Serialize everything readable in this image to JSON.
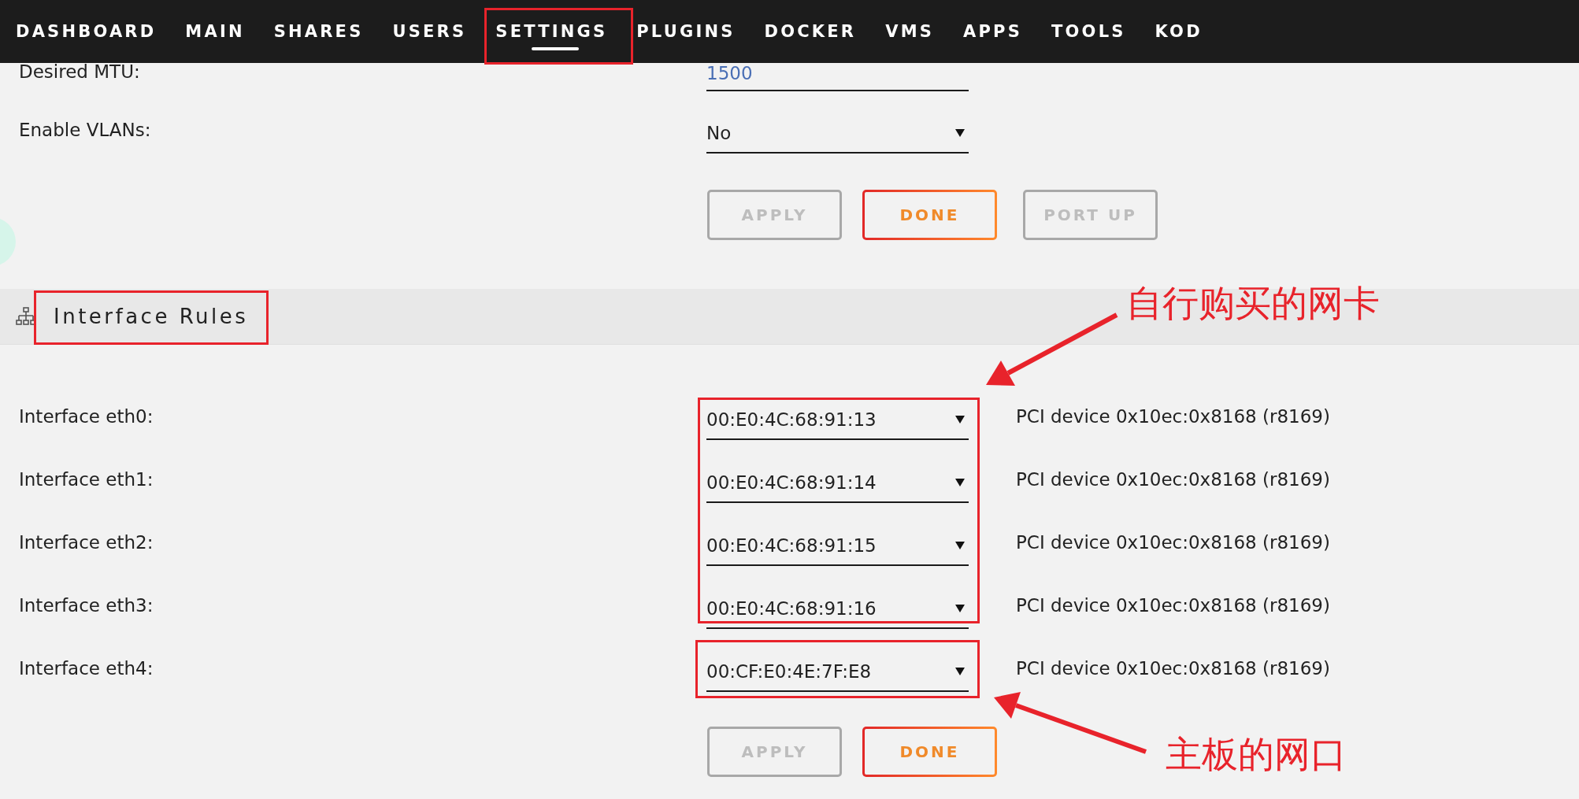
{
  "nav": {
    "items": [
      {
        "label": "DASHBOARD",
        "selected": false
      },
      {
        "label": "MAIN",
        "selected": false
      },
      {
        "label": "SHARES",
        "selected": false
      },
      {
        "label": "USERS",
        "selected": false
      },
      {
        "label": "SETTINGS",
        "selected": true
      },
      {
        "label": "PLUGINS",
        "selected": false
      },
      {
        "label": "DOCKER",
        "selected": false
      },
      {
        "label": "VMS",
        "selected": false
      },
      {
        "label": "APPS",
        "selected": false
      },
      {
        "label": "TOOLS",
        "selected": false
      },
      {
        "label": "KOD",
        "selected": false
      }
    ]
  },
  "settings": [
    {
      "kind": "input",
      "label": "Desired MTU:",
      "value": "1500"
    },
    {
      "kind": "select",
      "label": "Enable VLANs:",
      "value": "No"
    }
  ],
  "buttons": [
    {
      "label": "APPLY",
      "disabled": true
    },
    {
      "label": "DONE",
      "disabled": false
    },
    {
      "label": "PORT UP",
      "disabled": true
    }
  ],
  "section": {
    "title": "Interface Rules"
  },
  "interfaces": [
    {
      "label": "Interface eth0:",
      "value": "00:E0:4C:68:91:13",
      "description": "PCI device 0x10ec:0x8168 (r8169)"
    },
    {
      "label": "Interface eth1:",
      "value": "00:E0:4C:68:91:14",
      "description": "PCI device 0x10ec:0x8168 (r8169)"
    },
    {
      "label": "Interface eth2:",
      "value": "00:E0:4C:68:91:15",
      "description": "PCI device 0x10ec:0x8168 (r8169)"
    },
    {
      "label": "Interface eth3:",
      "value": "00:E0:4C:68:91:16",
      "description": "PCI device 0x10ec:0x8168 (r8169)"
    },
    {
      "label": "Interface eth4:",
      "value": "00:CF:E0:4E:7F:E8",
      "description": "PCI device 0x10ec:0x8168 (r8169)"
    }
  ],
  "interface_buttons": [
    {
      "label": "APPLY",
      "disabled": true
    },
    {
      "label": "DONE",
      "disabled": false
    }
  ],
  "annotations": [
    {
      "text": "自行购买的网卡"
    },
    {
      "text": "主板的网口"
    }
  ]
}
